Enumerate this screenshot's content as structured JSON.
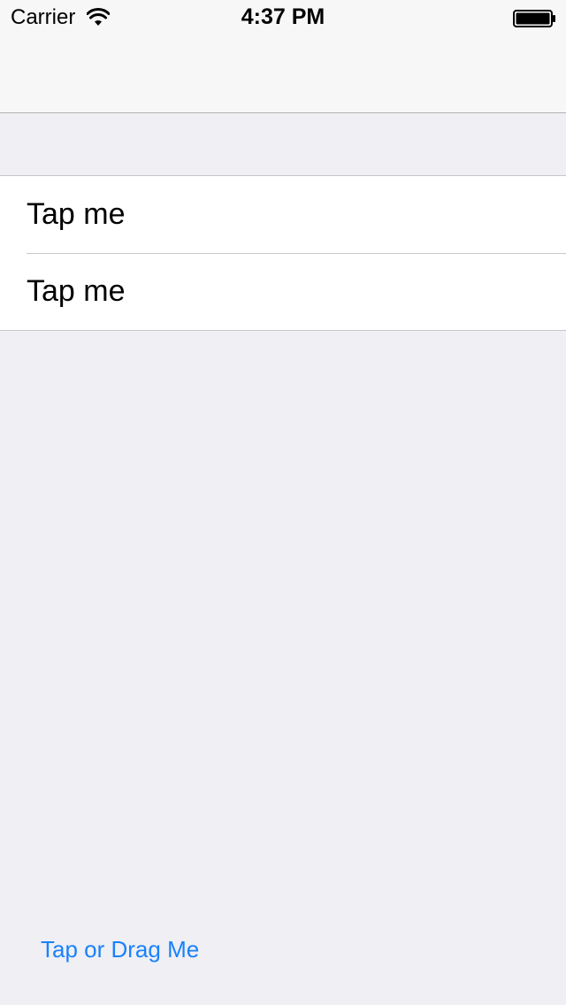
{
  "status_bar": {
    "carrier": "Carrier",
    "time": "4:37 PM",
    "wifi_icon": "wifi-icon",
    "battery_icon": "battery-icon"
  },
  "table": {
    "rows": [
      {
        "label": "Tap me"
      },
      {
        "label": "Tap me"
      }
    ]
  },
  "drag_button": {
    "label": "Tap or Drag Me",
    "color": "#1a82fb"
  },
  "colors": {
    "background": "#efeff4",
    "navbar": "#f7f7f7",
    "separator": "#c8c7cc"
  }
}
